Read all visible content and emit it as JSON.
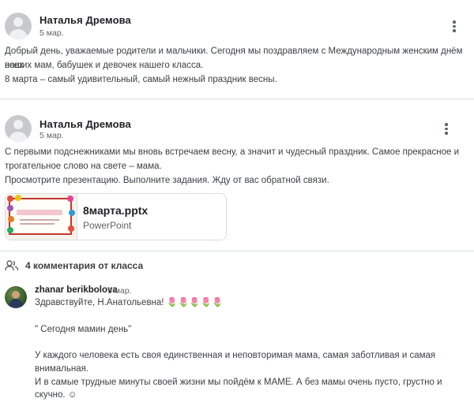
{
  "post1": {
    "author": "Наталья Дремова",
    "date": "5 мар.",
    "lines": [
      "Добрый день, уважаемые родители и мальчики. Сегодня мы поздравляем с Международным женским днём всех",
      "наших мам, бабушек и девочек нашего класса.",
      "8 марта – самый удивительный, самый нежный праздник весны."
    ],
    "menu_icon": "more-vert-icon"
  },
  "post2": {
    "author": "Наталья Дремова",
    "date": "5 мар.",
    "lines": [
      "С первыми подснежниками мы вновь встречаем весну, а значит и чудесный праздник. Самое прекрасное и",
      "трогательное слово на свете – мама.",
      "Просмотрите презентацию. Выполните задания. Жду от вас обратной связи."
    ],
    "menu_icon": "more-vert-icon",
    "attachment": {
      "name": "8марта.pptx",
      "type": "PowerPoint"
    }
  },
  "comments": {
    "icon": "people-icon",
    "header": "4 комментария от класса",
    "items": [
      {
        "author": "zhanar berikbolova",
        "date": "5 мар.",
        "lines": [
          "Здравствуйте, Н.Анатольевна! 🌷🌷🌷🌷🌷",
          "",
          "\" Сегодня мамин день\"",
          "",
          "У каждого человека есть своя единственная и неповторимая мама, самая заботливая и самая",
          "внимальная.",
          "И в самые трудные минуты своей жизни мы пойдём к МАМЕ. А без мамы очень пусто, грустно и",
          "скучно. ☺"
        ]
      }
    ]
  }
}
